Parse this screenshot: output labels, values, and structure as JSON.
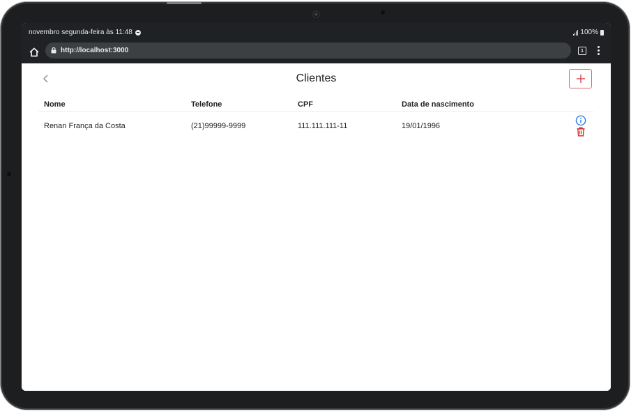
{
  "statusbar": {
    "time_text": "novembro segunda-feira às 11:48",
    "battery_text": "100%"
  },
  "browser": {
    "url": "http://localhost:3000",
    "tabs_count": "1"
  },
  "page": {
    "title": "Clientes",
    "back_icon": "chevron-left-icon",
    "add_icon": "plus-icon"
  },
  "table": {
    "headers": [
      "Nome",
      "Telefone",
      "CPF",
      "Data de nascimento"
    ],
    "rows": [
      [
        "Renan França da Costa",
        "(21)99999-9999",
        "111.111.111-11",
        "19/01/1996"
      ]
    ]
  },
  "colors": {
    "accent_red": "#d94141",
    "info_blue": "#1a73e8",
    "chrome_dark": "#202124"
  }
}
